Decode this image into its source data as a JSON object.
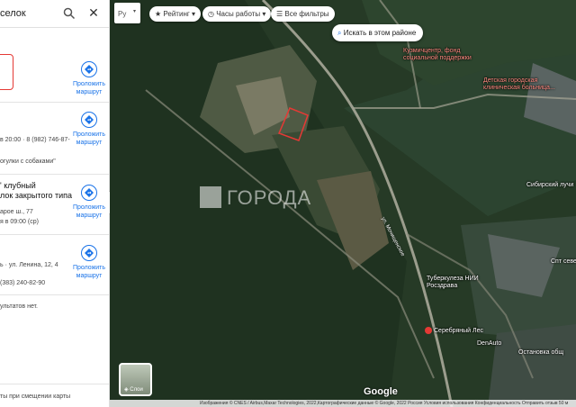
{
  "sidebar": {
    "search_value": "селок",
    "results": [
      {
        "route_label": "Проложить маршрут"
      },
      {
        "route_label": "Проложить маршрут",
        "hours_line": "в 20:00 · 8 (982) 746-87-",
        "note": "огулки с собаками\""
      },
      {
        "route_label": "Проложить маршрут",
        "title_line1": "' клубный",
        "title_line2": "лок закрытого типа",
        "addr_line": "арое ш., 77",
        "hours_line": "я в 09:00 (ср)"
      },
      {
        "route_label": "Проложить маршрут",
        "addr_line": "ь · ул. Ленина, 12, 4",
        "phone_line": "(383) 240-82-90"
      }
    ],
    "no_more": "ультатов нет.",
    "footer": "ты при смещении карты"
  },
  "map": {
    "lang": "Ру",
    "filters": {
      "rating": "Рейтинг",
      "hours": "Часы работы",
      "all": "Все фильтры"
    },
    "search_area": "Искать в этом районе",
    "places": {
      "kuzmich": "Кузмичцентр, фонд социальной поддержки",
      "hospital": "Детская городская клиническая больница...",
      "sibirsky": "Сибирский лучи",
      "sever": "Спт севе",
      "tuberculosis": "Туберкулеза НИИ Росздрава",
      "forest": "Серебряный Лес",
      "denauto": "DenAuto",
      "ostanovka": "Остановка общ"
    },
    "road": "ул. Мочищенское",
    "watermark": "ГОРОДА",
    "layers_label": "Слои",
    "google": "Google",
    "attribution": "Изображения © CNES / Airbus,Maxar Technologies, 2022,Картографические данные © Google, 2022    Россия    Условия использования    Конфиденциальность    Отправить отзыв    50 м"
  },
  "colors": {
    "accent": "#1a73e8",
    "red": "#e53935"
  }
}
